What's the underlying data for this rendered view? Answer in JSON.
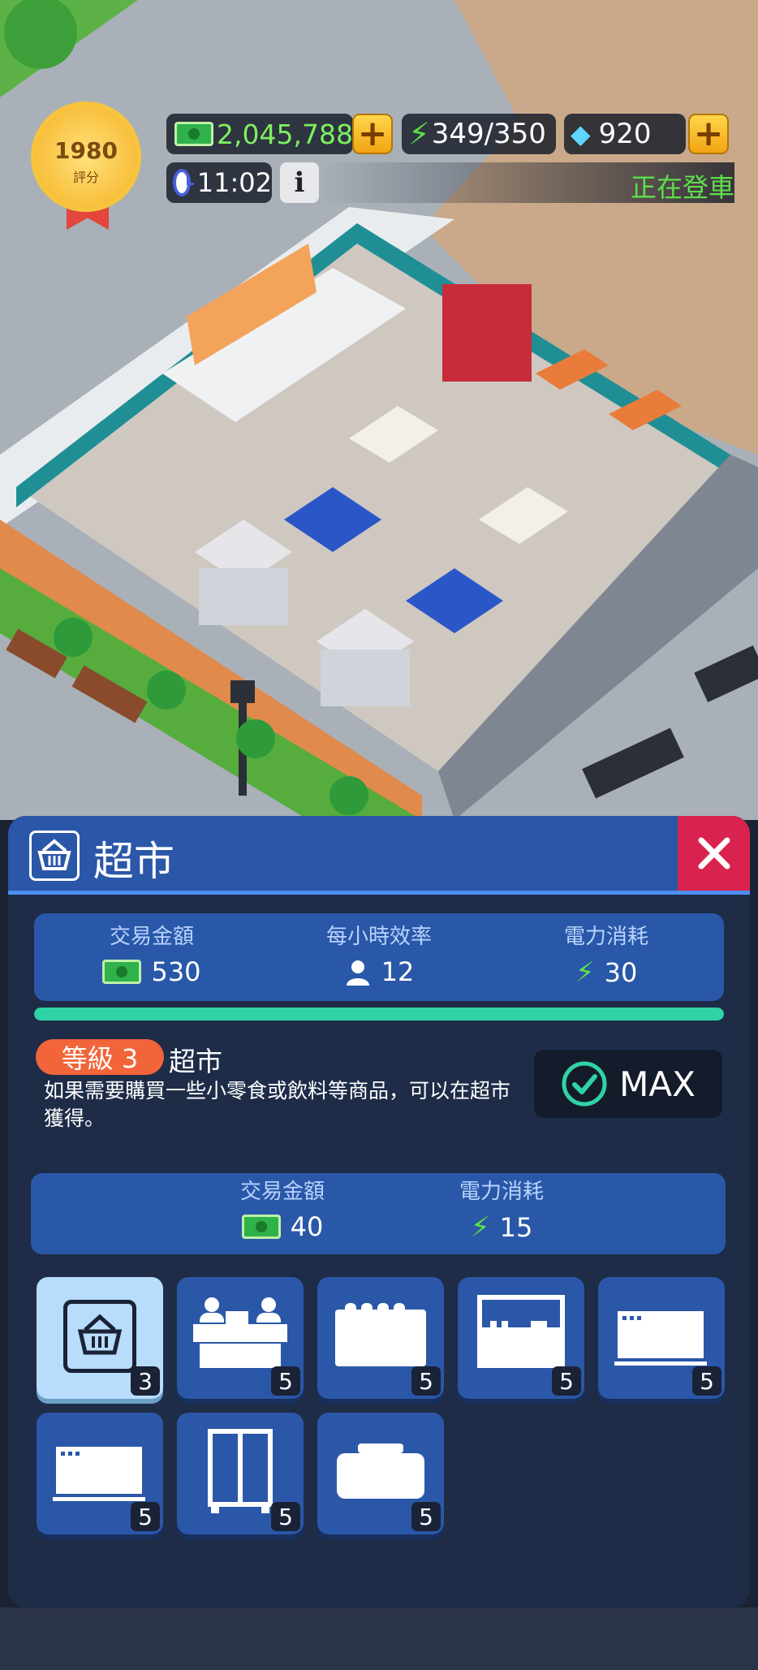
{
  "hud": {
    "rating": "1980",
    "rating_label": "評分",
    "cash": "2,045,788",
    "energy": "349/350",
    "gems": "920",
    "clock": "11:02",
    "info": "i",
    "status": "正在登車"
  },
  "panel": {
    "title": "超市",
    "stats": [
      {
        "label": "交易金額",
        "value": "530",
        "icon": "cash-icon"
      },
      {
        "label": "每小時效率",
        "value": "12",
        "icon": "person-icon"
      },
      {
        "label": "電力消耗",
        "value": "30",
        "icon": "lightning-icon"
      }
    ],
    "progress": 1.0,
    "level_badge": "等級 3",
    "facility_name": "超市",
    "description": "如果需要購買一些小零食或飲料等商品，可以在超市獲得。",
    "max_label": "MAX",
    "upgrade_stats": [
      {
        "label": "交易金額",
        "value": "40",
        "icon": "cash-icon"
      },
      {
        "label": "電力消耗",
        "value": "15",
        "icon": "lightning-icon"
      }
    ],
    "items": [
      {
        "icon": "basket-icon",
        "count": "3",
        "active": true
      },
      {
        "icon": "cashier-counter-icon",
        "count": "5"
      },
      {
        "icon": "bakery-display-icon",
        "count": "5"
      },
      {
        "icon": "snack-shelf-icon",
        "count": "5"
      },
      {
        "icon": "freezer-icon",
        "count": "5"
      },
      {
        "icon": "freezer-icon",
        "count": "5"
      },
      {
        "icon": "fridge-icon",
        "count": "5"
      },
      {
        "icon": "chest-freezer-icon",
        "count": "5"
      }
    ]
  },
  "colors": {
    "panel_bg": "#1e2c48",
    "header_blue": "#2b57a8",
    "accent_teal": "#2fd3a7",
    "close_red": "#d8234e",
    "level_orange": "#f2653a"
  }
}
